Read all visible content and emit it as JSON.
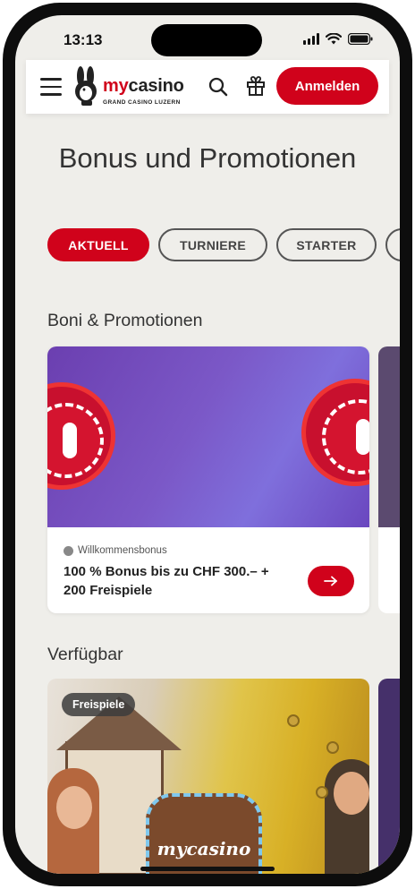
{
  "status_bar": {
    "time": "13:13"
  },
  "header": {
    "logo_text_my": "my",
    "logo_text_casino": "casino",
    "logo_subtitle": "GRAND CASINO LUZERN",
    "login_label": "Anmelden"
  },
  "page": {
    "title": "Bonus und Promotionen"
  },
  "filters": [
    {
      "label": "AKTUELL",
      "active": true
    },
    {
      "label": "TURNIERE",
      "active": false
    },
    {
      "label": "STARTER",
      "active": false
    }
  ],
  "sections": {
    "promotions_title": "Boni & Promotionen",
    "available_title": "Verfügbar"
  },
  "promo_card": {
    "category": "Willkommensbonus",
    "text": "100 % Bonus bis zu CHF 300.– + 200 Freispiele"
  },
  "game_card": {
    "tag": "Freispiele",
    "logo_text": "mycasino"
  },
  "colors": {
    "brand_red": "#d0021b",
    "background": "#efeeea"
  }
}
